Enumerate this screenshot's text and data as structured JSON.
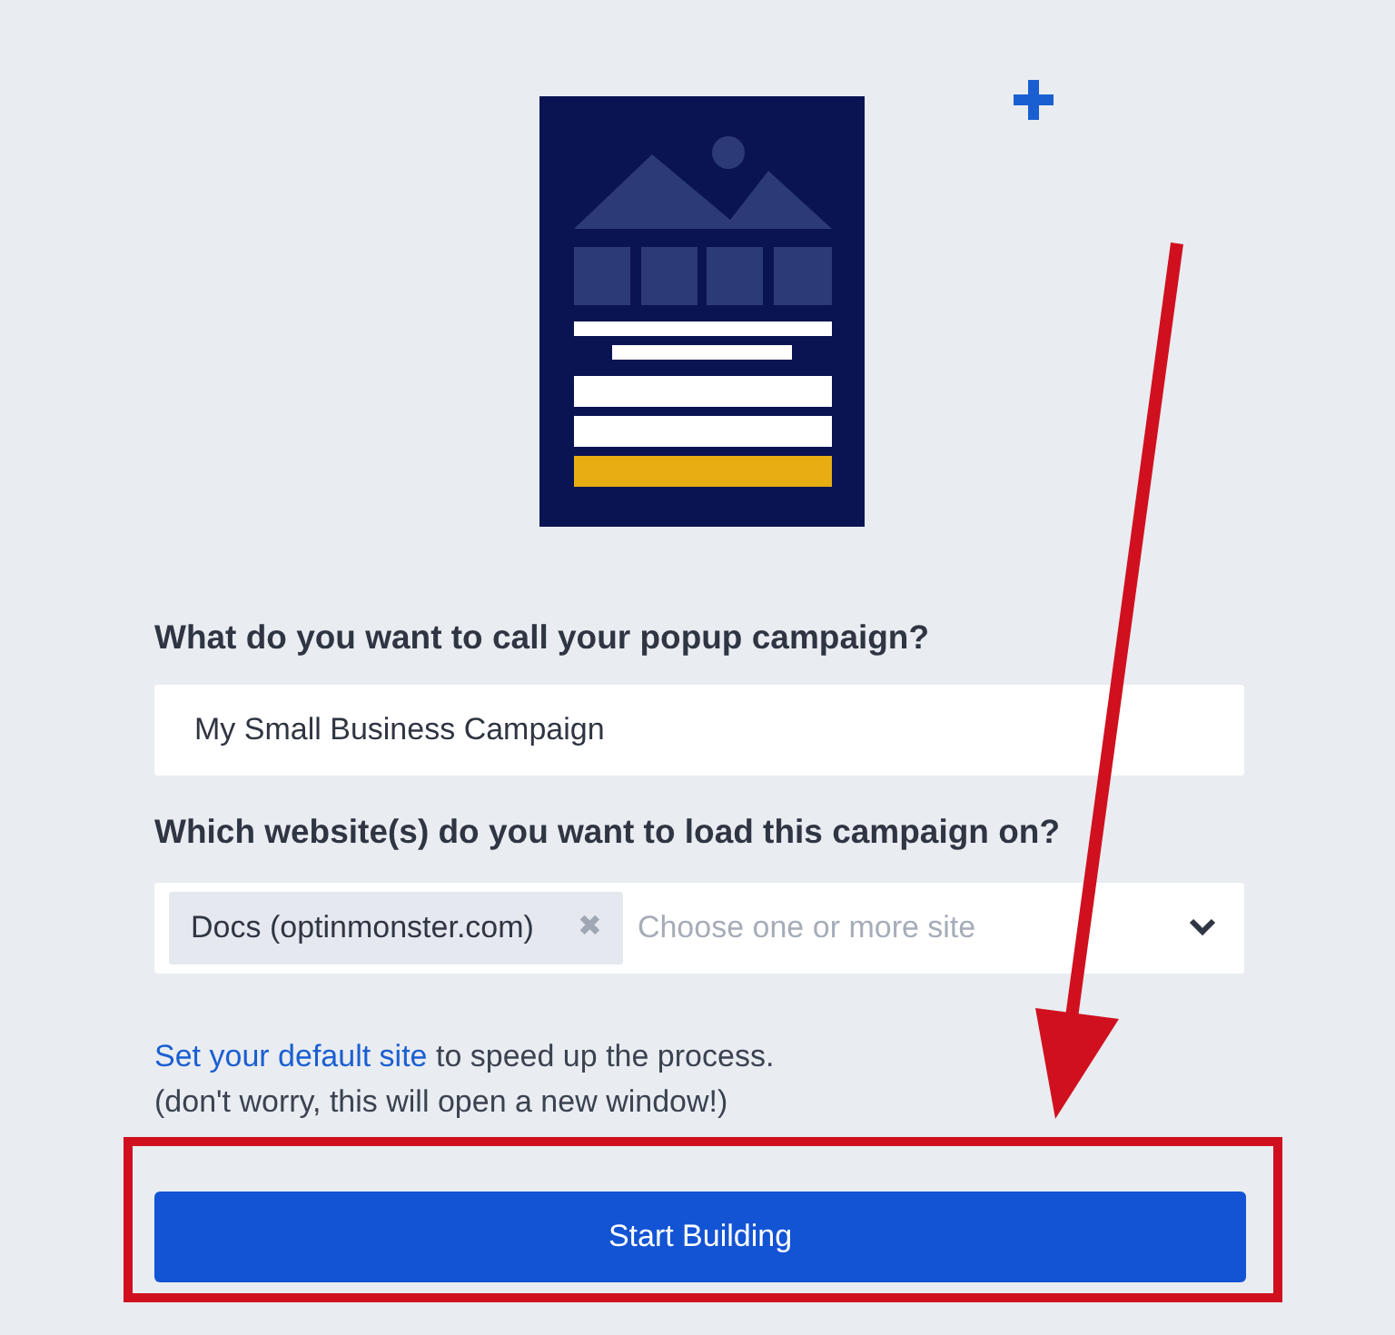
{
  "campaign_name": {
    "label": "What do you want to call your popup campaign?",
    "value": "My Small Business Campaign"
  },
  "websites": {
    "label": "Which website(s) do you want to load this campaign on?",
    "chips": [
      {
        "label": "Docs (optinmonster.com)",
        "remove": "✖"
      }
    ],
    "placeholder": "Choose one or more site"
  },
  "help": {
    "link": "Set your default site",
    "text": " to speed up the process.",
    "note": "(don't worry, this will open a new window!)"
  },
  "button": "Start Building"
}
